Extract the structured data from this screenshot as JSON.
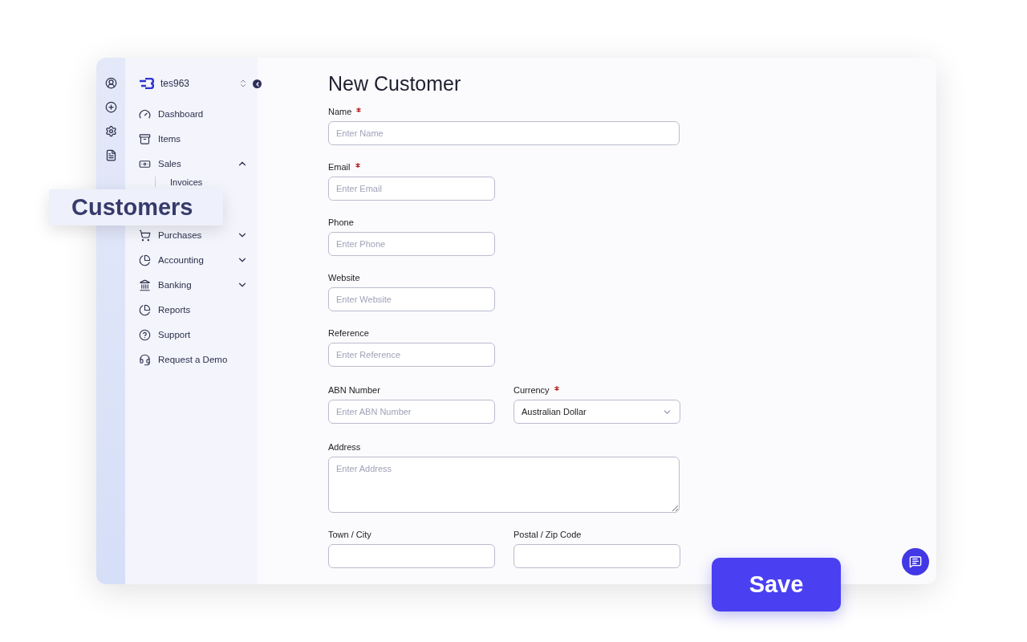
{
  "sidebar": {
    "workspace": "tes963",
    "items": [
      {
        "label": "Dashboard"
      },
      {
        "label": "Items"
      },
      {
        "label": "Sales",
        "expanded": true,
        "children": [
          {
            "label": "Invoices"
          }
        ]
      },
      {
        "label": "Purchases",
        "expanded": false
      },
      {
        "label": "Accounting",
        "expanded": false
      },
      {
        "label": "Banking",
        "expanded": false
      },
      {
        "label": "Reports"
      },
      {
        "label": "Support"
      },
      {
        "label": "Request a Demo"
      }
    ]
  },
  "form": {
    "title": "New Customer",
    "sections": [
      [
        [
          {
            "label": "Name",
            "required": true,
            "kind": "text",
            "wide": true,
            "placeholder": "Enter Name"
          }
        ],
        [
          {
            "label": "Email",
            "required": true,
            "kind": "text",
            "wide": false,
            "placeholder": "Enter Email"
          }
        ],
        [
          {
            "label": "Phone",
            "required": false,
            "kind": "text",
            "wide": false,
            "placeholder": "Enter Phone"
          }
        ],
        [
          {
            "label": "Website",
            "required": false,
            "kind": "text",
            "wide": false,
            "placeholder": "Enter Website"
          }
        ],
        [
          {
            "label": "Reference",
            "required": false,
            "kind": "text",
            "wide": false,
            "placeholder": "Enter Reference"
          }
        ]
      ],
      [
        [
          {
            "label": "ABN Number",
            "required": false,
            "kind": "text",
            "wide": false,
            "placeholder": "Enter ABN Number"
          },
          {
            "label": "Currency",
            "required": true,
            "kind": "select",
            "wide": false,
            "value": "Australian Dollar"
          }
        ]
      ],
      [
        [
          {
            "label": "Address",
            "required": false,
            "kind": "textarea",
            "wide": true,
            "placeholder": "Enter Address"
          }
        ],
        [
          {
            "label": "Town / City",
            "required": false,
            "kind": "text",
            "wide": false
          },
          {
            "label": "Postal / Zip Code",
            "required": false,
            "kind": "text",
            "wide": false
          }
        ]
      ]
    ]
  },
  "callout": {
    "label": "Customers"
  },
  "save_button": {
    "label": "Save"
  }
}
